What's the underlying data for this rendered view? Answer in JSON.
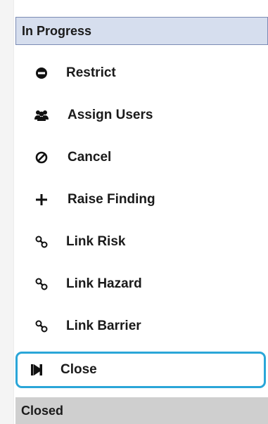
{
  "sections": {
    "in_progress": "In Progress",
    "closed": "Closed"
  },
  "menu": {
    "items": [
      {
        "label": "Restrict",
        "icon": "minus-circle-icon"
      },
      {
        "label": "Assign Users",
        "icon": "users-icon"
      },
      {
        "label": "Cancel",
        "icon": "ban-icon"
      },
      {
        "label": "Raise Finding",
        "icon": "plus-icon"
      },
      {
        "label": "Link Risk",
        "icon": "link-icon"
      },
      {
        "label": "Link Hazard",
        "icon": "link-icon"
      },
      {
        "label": "Link Barrier",
        "icon": "link-icon"
      },
      {
        "label": "Close",
        "icon": "step-forward-icon",
        "selected": true
      }
    ]
  },
  "colors": {
    "header_in_progress_bg": "#d6deee",
    "header_in_progress_border": "#7b8bb4",
    "header_closed_bg": "#cfcfcf",
    "selected_border": "#2aa6d8"
  }
}
